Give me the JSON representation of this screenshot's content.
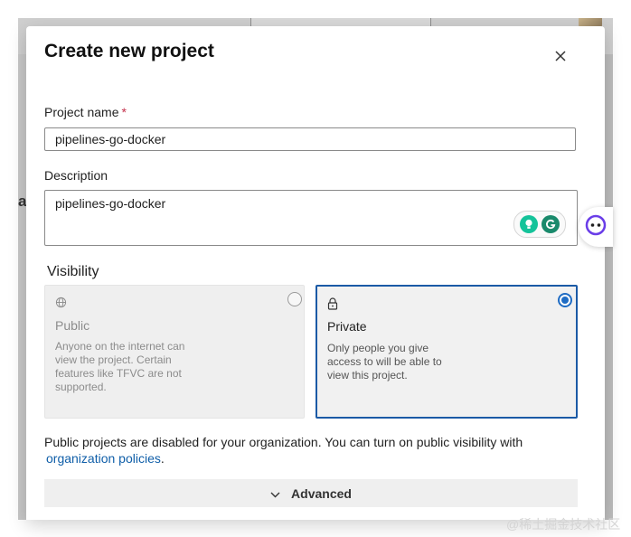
{
  "dialog": {
    "title": "Create new project"
  },
  "project_name": {
    "label": "Project name",
    "required_mark": "*",
    "value": "pipelines-go-docker"
  },
  "description": {
    "label": "Description",
    "value": "pipelines-go-docker"
  },
  "visibility": {
    "title": "Visibility",
    "options": [
      {
        "label": "Public",
        "icon": "globe-icon",
        "description": "Anyone on the internet can view the project. Certain features like TFVC are not supported.",
        "selected": false,
        "disabled": true
      },
      {
        "label": "Private",
        "icon": "lock-icon",
        "description": "Only people you give access to will be able to view this project.",
        "selected": true,
        "disabled": false
      }
    ]
  },
  "notice": {
    "text": "Public projects are disabled for your organization. You can turn on public visibility with",
    "link": "organization policies",
    "suffix": "."
  },
  "advanced": {
    "label": "Advanced"
  },
  "background": {
    "letter": "a"
  },
  "watermark": "@稀土掘金技术社区",
  "colors": {
    "accent": "#1f6cc4",
    "link": "#0f5ea8",
    "required": "#c4314b",
    "grammarly": "#15c39a"
  }
}
